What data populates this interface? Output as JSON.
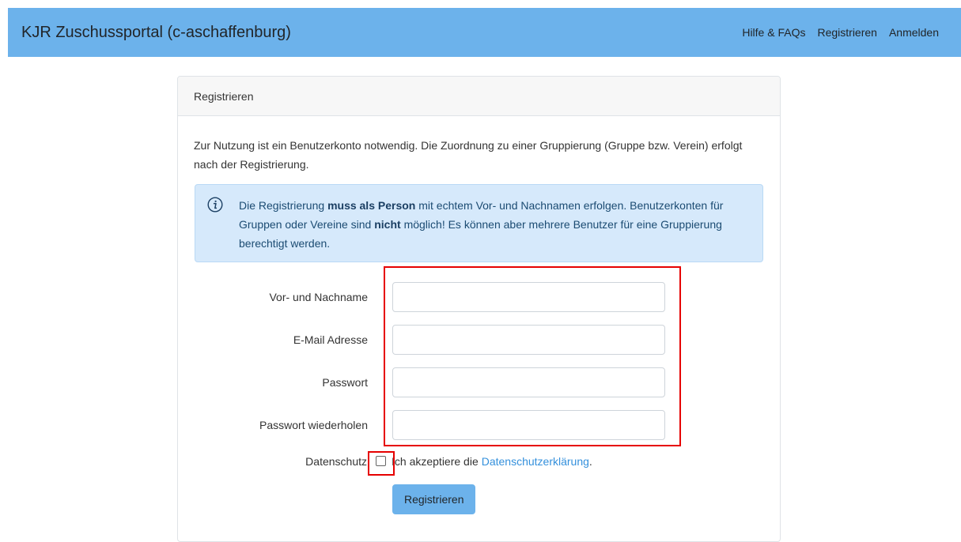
{
  "navbar": {
    "brand": "KJR Zuschussportal (c-aschaffenburg)",
    "links": [
      "Hilfe & FAQs",
      "Registrieren",
      "Anmelden"
    ]
  },
  "card": {
    "header": "Registrieren",
    "intro": "Zur Nutzung ist ein Benutzerkonto notwendig. Die Zuordnung zu einer Gruppierung (Gruppe bzw. Verein) erfolgt nach der Registrierung.",
    "alert": {
      "icon": "info-icon",
      "part1": "Die Registrierung ",
      "bold1": "muss als Person",
      "part2": " mit echtem Vor- und Nachnamen erfolgen. Benutzerkonten für Gruppen oder Vereine sind ",
      "bold2": "nicht",
      "part3": " möglich! Es können aber mehrere Benutzer für eine Gruppierung berechtigt werden."
    },
    "form": {
      "fields": [
        {
          "label": "Vor- und Nachname",
          "value": ""
        },
        {
          "label": "E-Mail Adresse",
          "value": ""
        },
        {
          "label": "Passwort",
          "value": ""
        },
        {
          "label": "Passwort wiederholen",
          "value": ""
        }
      ],
      "privacy_label": "Datenschutz",
      "privacy_text": "Ich akzeptiere die",
      "privacy_link": "Datenschutzerklärung",
      "privacy_suffix": ".",
      "submit_label": "Registrieren"
    }
  },
  "colors": {
    "navbar": "#6cb2eb",
    "alert_bg": "#d6e9fb",
    "link": "#3490dc",
    "highlight": "#e60000"
  }
}
